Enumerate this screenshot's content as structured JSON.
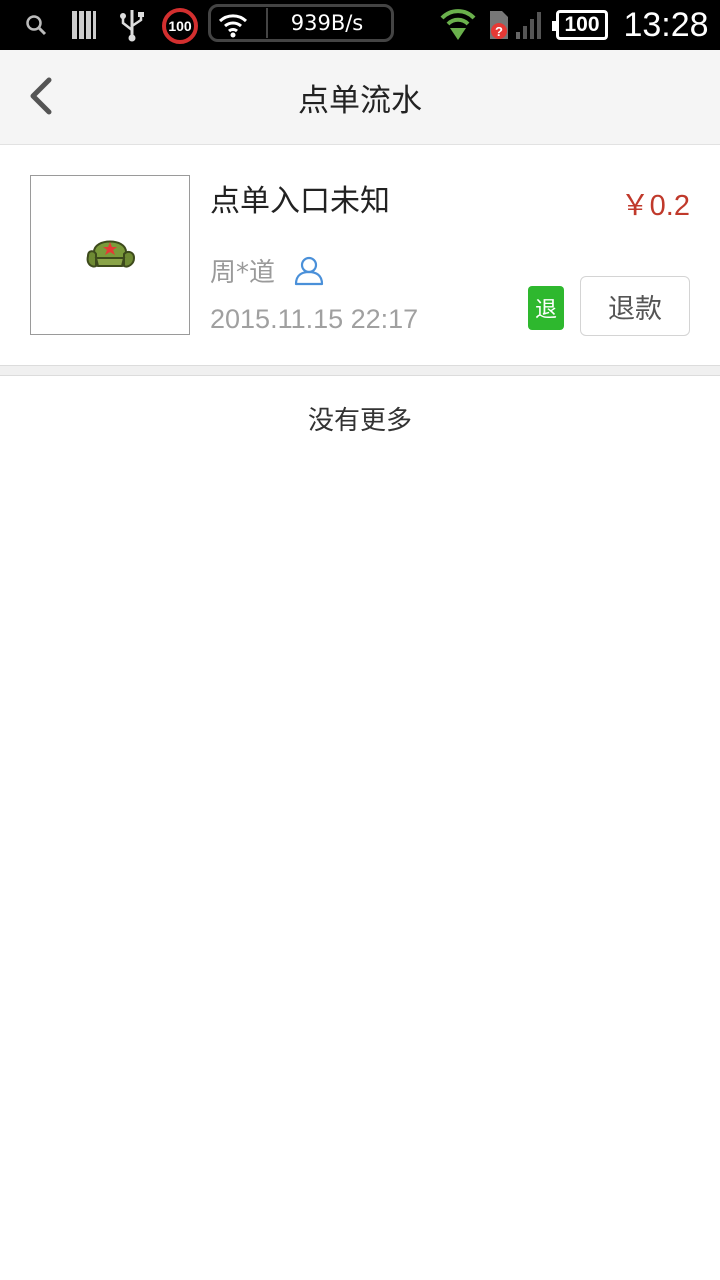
{
  "status_bar": {
    "badge_value": "100",
    "net_speed": "939B/s",
    "battery": "100",
    "time": "13:28",
    "icons": [
      "search-icon",
      "battery-bars-icon",
      "usb-icon",
      "speed-limit-icon",
      "wifi-icon",
      "wifi-download-icon",
      "sim-error-icon",
      "signal-icon",
      "battery-icon"
    ]
  },
  "header": {
    "title": "点单流水",
    "back_icon": "chevron-left-icon"
  },
  "order": {
    "title": "点单入口未知",
    "price": "￥0.2",
    "user": "周*道",
    "time": "2015.11.15 22:17",
    "refund_badge": "退",
    "refund_button": "退款",
    "colors": {
      "price": "#c0392b",
      "badge": "#2eb82e",
      "user_icon": "#4a90d9"
    }
  },
  "footer": {
    "no_more": "没有更多"
  }
}
